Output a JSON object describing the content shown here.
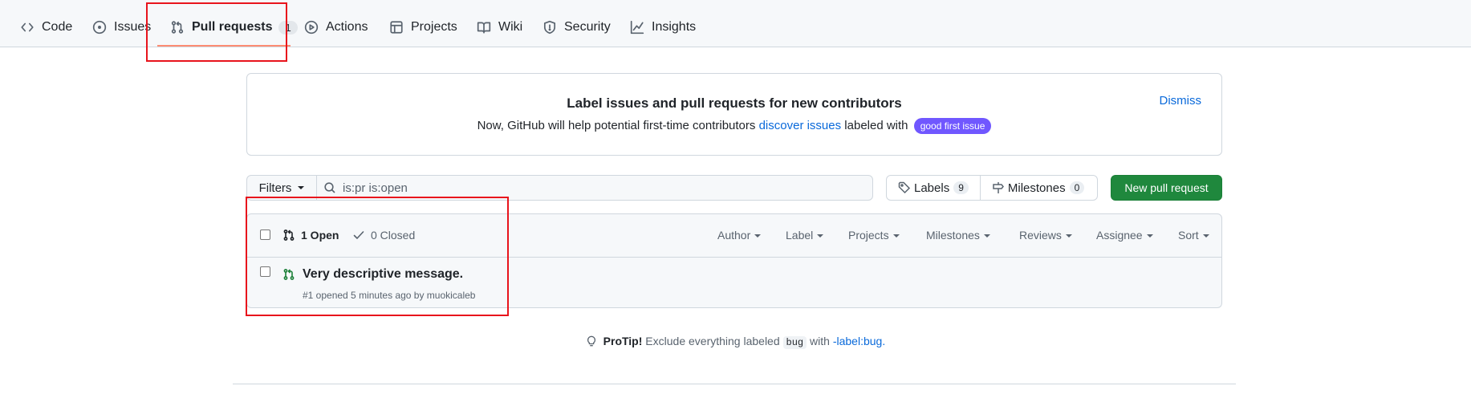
{
  "nav": {
    "items": [
      {
        "label": "Code",
        "icon": "code-icon"
      },
      {
        "label": "Issues",
        "icon": "issue-opened-icon"
      },
      {
        "label": "Pull requests",
        "icon": "git-pull-request-icon",
        "count": "1",
        "selected": true
      },
      {
        "label": "Actions",
        "icon": "play-icon"
      },
      {
        "label": "Projects",
        "icon": "table-icon"
      },
      {
        "label": "Wiki",
        "icon": "book-icon"
      },
      {
        "label": "Security",
        "icon": "shield-icon"
      },
      {
        "label": "Insights",
        "icon": "graph-icon"
      }
    ]
  },
  "banner": {
    "title": "Label issues and pull requests for new contributors",
    "text_before": "Now, GitHub will help potential first-time contributors",
    "link": "discover issues",
    "text_after": "labeled with",
    "label": "good first issue",
    "dismiss": "Dismiss"
  },
  "toolbar": {
    "filters": "Filters",
    "search_value": "is:pr is:open",
    "labels": "Labels",
    "labels_count": "9",
    "milestones": "Milestones",
    "milestones_count": "0",
    "new_pr": "New pull request"
  },
  "list": {
    "open": "1 Open",
    "closed": "0 Closed",
    "filters": [
      "Author",
      "Label",
      "Projects",
      "Milestones",
      "Reviews",
      "Assignee",
      "Sort"
    ],
    "rows": [
      {
        "title": "Very descriptive message.",
        "meta": "#1 opened 5 minutes ago by muokicaleb"
      }
    ]
  },
  "protip": {
    "lead": "ProTip!",
    "text1": "Exclude everything labeled",
    "code": "bug",
    "text2": "with",
    "link": "-label:bug",
    "end": "."
  },
  "colors": {
    "accent_link": "#0969da",
    "primary_button": "#1f883d",
    "good_first_issue": "#7057ff",
    "nav_underline": "#fd8c73",
    "annotation_box": "#e8141c"
  }
}
